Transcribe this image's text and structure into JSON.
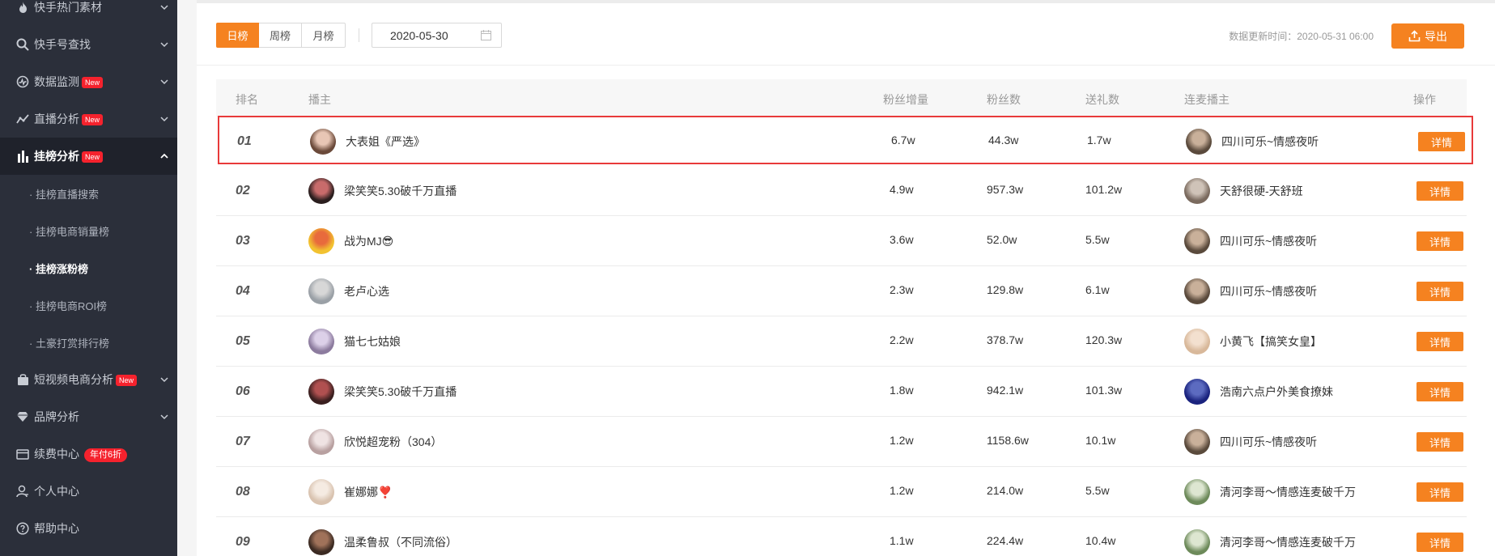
{
  "sidebar": {
    "items": [
      {
        "label": "快手热门素材",
        "icon": "fire-icon",
        "badge": ""
      },
      {
        "label": "快手号查找",
        "icon": "search-icon",
        "badge": ""
      },
      {
        "label": "数据监测",
        "icon": "monitor-icon",
        "badge": "New"
      },
      {
        "label": "直播分析",
        "icon": "trend-icon",
        "badge": "New"
      },
      {
        "label": "挂榜分析",
        "icon": "bar-chart-icon",
        "badge": "New"
      },
      {
        "label": "短视频电商分析",
        "icon": "bag-icon",
        "badge": "New"
      },
      {
        "label": "品牌分析",
        "icon": "diamond-icon",
        "badge": ""
      },
      {
        "label": "续费中心",
        "icon": "card-icon",
        "badge": "年付6折"
      },
      {
        "label": "个人中心",
        "icon": "user-icon",
        "badge": ""
      },
      {
        "label": "帮助中心",
        "icon": "help-icon",
        "badge": ""
      }
    ],
    "sub_items": [
      {
        "label": "· 挂榜直播搜索"
      },
      {
        "label": "· 挂榜电商销量榜"
      },
      {
        "label": "· 挂榜涨粉榜"
      },
      {
        "label": "· 挂榜电商ROI榜"
      },
      {
        "label": "· 土豪打赏排行榜"
      }
    ]
  },
  "toolbar": {
    "tabs": [
      "日榜",
      "周榜",
      "月榜"
    ],
    "active_tab": "日榜",
    "date_value": "2020-05-30",
    "update_time": "数据更新时间：2020-05-31 06:00",
    "export_label": "导出"
  },
  "table": {
    "headers": {
      "rank": "排名",
      "host": "播主",
      "fan_growth": "粉丝增量",
      "fans": "粉丝数",
      "gifts": "送礼数",
      "linked": "连麦播主",
      "action": "操作"
    },
    "detail_label": "详情",
    "rows": [
      {
        "rank": "01",
        "host": "大表姐《严选》",
        "fan_growth": "6.7w",
        "fans": "44.3w",
        "gifts": "1.7w",
        "linked": "四川可乐~情感夜听"
      },
      {
        "rank": "02",
        "host": "梁笑笑5.30破千万直播",
        "fan_growth": "4.9w",
        "fans": "957.3w",
        "gifts": "101.2w",
        "linked": "天舒很硬-天舒班"
      },
      {
        "rank": "03",
        "host": "战为MJ😎",
        "fan_growth": "3.6w",
        "fans": "52.0w",
        "gifts": "5.5w",
        "linked": "四川可乐~情感夜听"
      },
      {
        "rank": "04",
        "host": "老卢心选",
        "fan_growth": "2.3w",
        "fans": "129.8w",
        "gifts": "6.1w",
        "linked": "四川可乐~情感夜听"
      },
      {
        "rank": "05",
        "host": "猫七七姑娘",
        "fan_growth": "2.2w",
        "fans": "378.7w",
        "gifts": "120.3w",
        "linked": "小黄飞【搞笑女皇】"
      },
      {
        "rank": "06",
        "host": "梁笑笑5.30破千万直播",
        "fan_growth": "1.8w",
        "fans": "942.1w",
        "gifts": "101.3w",
        "linked": "浩南六点户外美食撩妹"
      },
      {
        "rank": "07",
        "host": "欣悦超宠粉（304）",
        "fan_growth": "1.2w",
        "fans": "1158.6w",
        "gifts": "10.1w",
        "linked": "四川可乐~情感夜听"
      },
      {
        "rank": "08",
        "host": "崔娜娜❣️",
        "fan_growth": "1.2w",
        "fans": "214.0w",
        "gifts": "5.5w",
        "linked": "清河李哥～情感连麦破千万"
      },
      {
        "rank": "09",
        "host": "温柔鲁叔（不同流俗）",
        "fan_growth": "1.1w",
        "fans": "224.4w",
        "gifts": "10.4w",
        "linked": "清河李哥～情感连麦破千万"
      }
    ]
  },
  "colors": {
    "accent": "#f58220",
    "sidebar_bg": "#2b2f3a",
    "highlight_border": "#e83a3a",
    "badge_red": "#f5222d"
  }
}
